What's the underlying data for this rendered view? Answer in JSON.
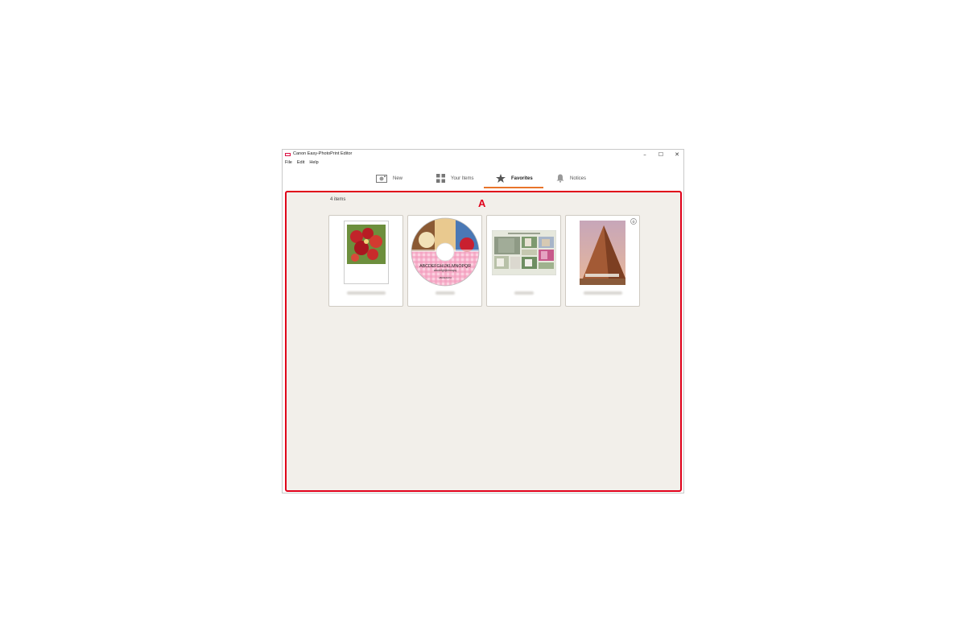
{
  "window": {
    "title": "Canon Easy-PhotoPrint Editor",
    "controls": {
      "minimize": "–",
      "maximize": "☐",
      "close": "✕"
    }
  },
  "menu": {
    "items": [
      "File",
      "Edit",
      "Help"
    ]
  },
  "tabs": [
    {
      "label": "New",
      "icon": "new-photo-icon",
      "active": false
    },
    {
      "label": "Your Items",
      "icon": "grid-icon",
      "active": false
    },
    {
      "label": "Favorites",
      "icon": "star-icon",
      "active": true
    },
    {
      "label": "Notices",
      "icon": "bell-icon",
      "active": false
    }
  ],
  "content": {
    "item_count": "4 items",
    "marker": "A",
    "items": [
      {
        "type": "photo-print",
        "thumbnail": "red-flowers"
      },
      {
        "type": "disc-label",
        "thumbnail": "cd-label",
        "disc_text": "ABCDEFGHIJKLMNOPQR",
        "disc_subtext": "abcdefghijklmnopq",
        "disc_footer": "ABCDEFGHIJ"
      },
      {
        "type": "collage",
        "thumbnail": "photo-collage"
      },
      {
        "type": "photo-print",
        "thumbnail": "pyramid",
        "cloud_icon": "download-icon"
      }
    ]
  },
  "colors": {
    "accent": "#e8742a",
    "highlight_border": "#e0001a",
    "content_bg": "#f2efea"
  }
}
